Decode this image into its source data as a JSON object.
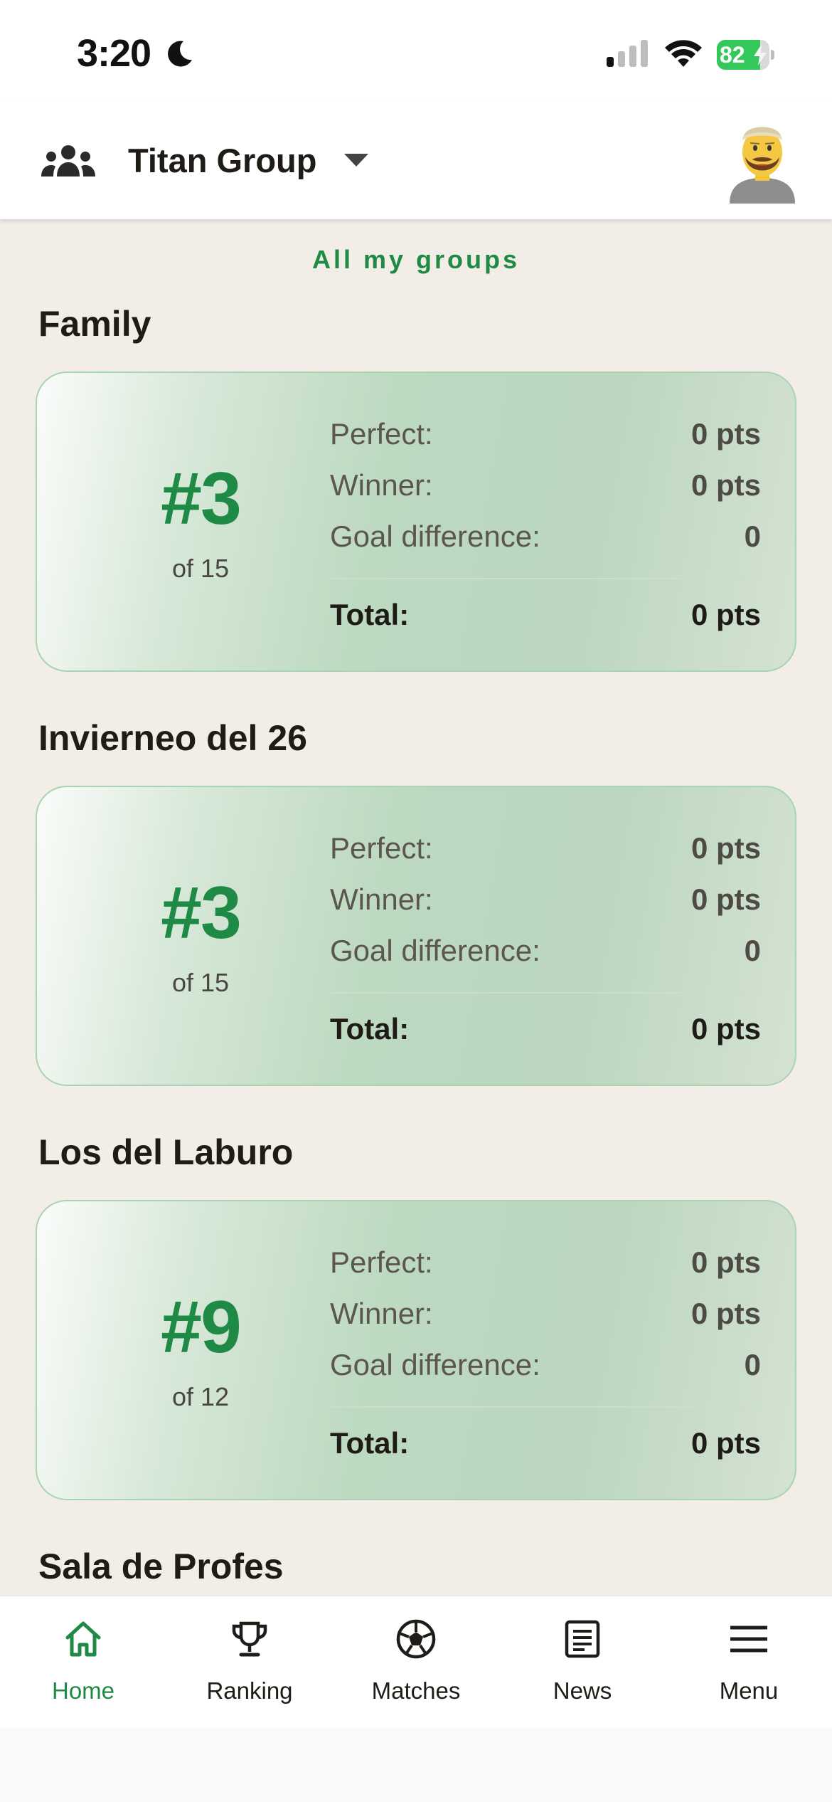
{
  "status_bar": {
    "time": "3:20",
    "battery_level": "82",
    "battery_fraction": 0.82,
    "colors": {
      "battery_fill": "#34c759"
    }
  },
  "header": {
    "group_icon": "group-icon",
    "title": "Titan Group",
    "dropdown_icon": "caret-down-icon",
    "avatar_icon": "avatar-bearded-man"
  },
  "content": {
    "all_groups_link": "All my groups",
    "groups": [
      {
        "name": "Family",
        "rank": "#3",
        "of": "of 15",
        "perfect_label": "Perfect:",
        "perfect_value": "0 pts",
        "winner_label": "Winner:",
        "winner_value": "0 pts",
        "goal_diff_label": "Goal difference:",
        "goal_diff_value": "0",
        "total_label": "Total:",
        "total_value": "0 pts"
      },
      {
        "name": "Invierneo del 26",
        "rank": "#3",
        "of": "of 15",
        "perfect_label": "Perfect:",
        "perfect_value": "0 pts",
        "winner_label": "Winner:",
        "winner_value": "0 pts",
        "goal_diff_label": "Goal difference:",
        "goal_diff_value": "0",
        "total_label": "Total:",
        "total_value": "0 pts"
      },
      {
        "name": "Los del Laburo",
        "rank": "#9",
        "of": "of 12",
        "perfect_label": "Perfect:",
        "perfect_value": "0 pts",
        "winner_label": "Winner:",
        "winner_value": "0 pts",
        "goal_diff_label": "Goal difference:",
        "goal_diff_value": "0",
        "total_label": "Total:",
        "total_value": "0 pts"
      },
      {
        "name": "Sala de Profes"
      }
    ]
  },
  "bottom_nav": {
    "items": [
      {
        "label": "Home",
        "icon": "home-icon",
        "active": true
      },
      {
        "label": "Ranking",
        "icon": "trophy-icon",
        "active": false
      },
      {
        "label": "Matches",
        "icon": "soccer-ball-icon",
        "active": false
      },
      {
        "label": "News",
        "icon": "news-icon",
        "active": false
      },
      {
        "label": "Menu",
        "icon": "menu-icon",
        "active": false
      }
    ]
  },
  "colors": {
    "accent": "#1f8a45",
    "background": "#f2ede6",
    "card_border": "#a9d3b2",
    "text": "#1f1b16"
  }
}
